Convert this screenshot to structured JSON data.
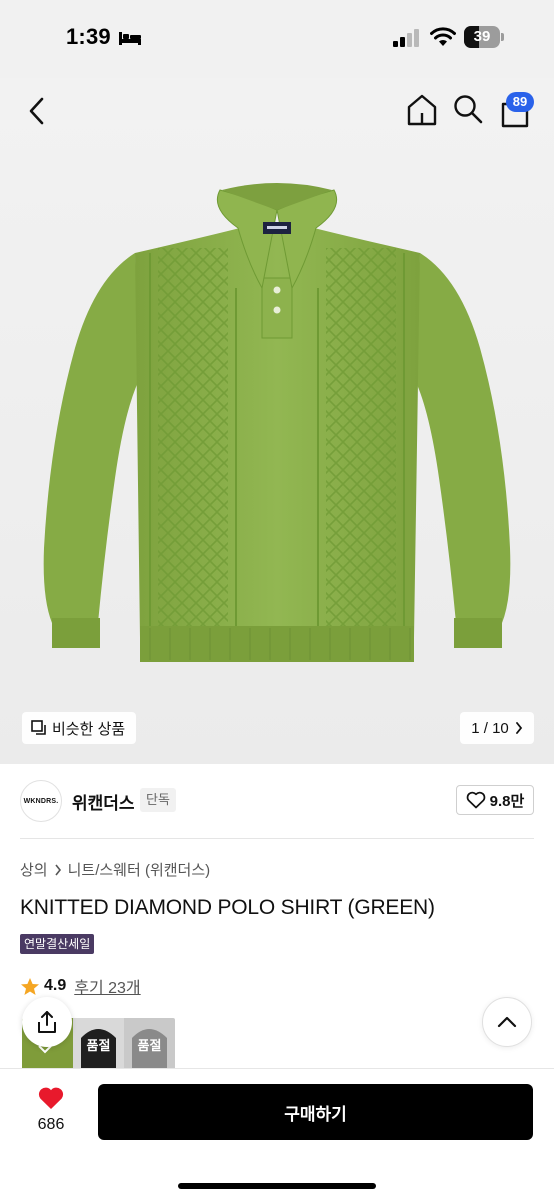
{
  "status_bar": {
    "time": "1:39",
    "battery_level": "39",
    "icons": [
      "sleep-focus-icon",
      "cellular-signal-icon",
      "wifi-icon",
      "battery-icon"
    ]
  },
  "nav": {
    "icons": [
      "back-chevron-icon",
      "home-icon",
      "search-icon",
      "shopping-bag-icon"
    ],
    "cart_count": "89"
  },
  "gallery": {
    "similar_label": "비슷한 상품",
    "page_indicator": "1 / 10"
  },
  "brand": {
    "logo_text": "WKNDRS.",
    "name": "위캔더스",
    "tag": "단독",
    "likes": "9.8만"
  },
  "product": {
    "breadcrumb": [
      "상의",
      "니트/스웨터 (위캔더스)"
    ],
    "title": "KNITTED DIAMOND POLO SHIRT (GREEN)",
    "sale_badge": "연말결산세일",
    "rating": "4.9",
    "review_link": "후기 23개"
  },
  "thumbnails": [
    {
      "label": "",
      "color": "#7f9c3a"
    },
    {
      "label": "품절",
      "color": "#1f1f1f"
    },
    {
      "label": "품절",
      "color": "#8a8a8a"
    }
  ],
  "bottom_bar": {
    "like_count": "686",
    "buy_label": "구매하기"
  },
  "colors": {
    "accent_blue": "#2a62ea",
    "heart_red": "#e8192c",
    "star_orange": "#f5a623",
    "sweater_green": "#8bb04a",
    "sale_badge": "#4a3a63",
    "buy_button": "#000000"
  }
}
